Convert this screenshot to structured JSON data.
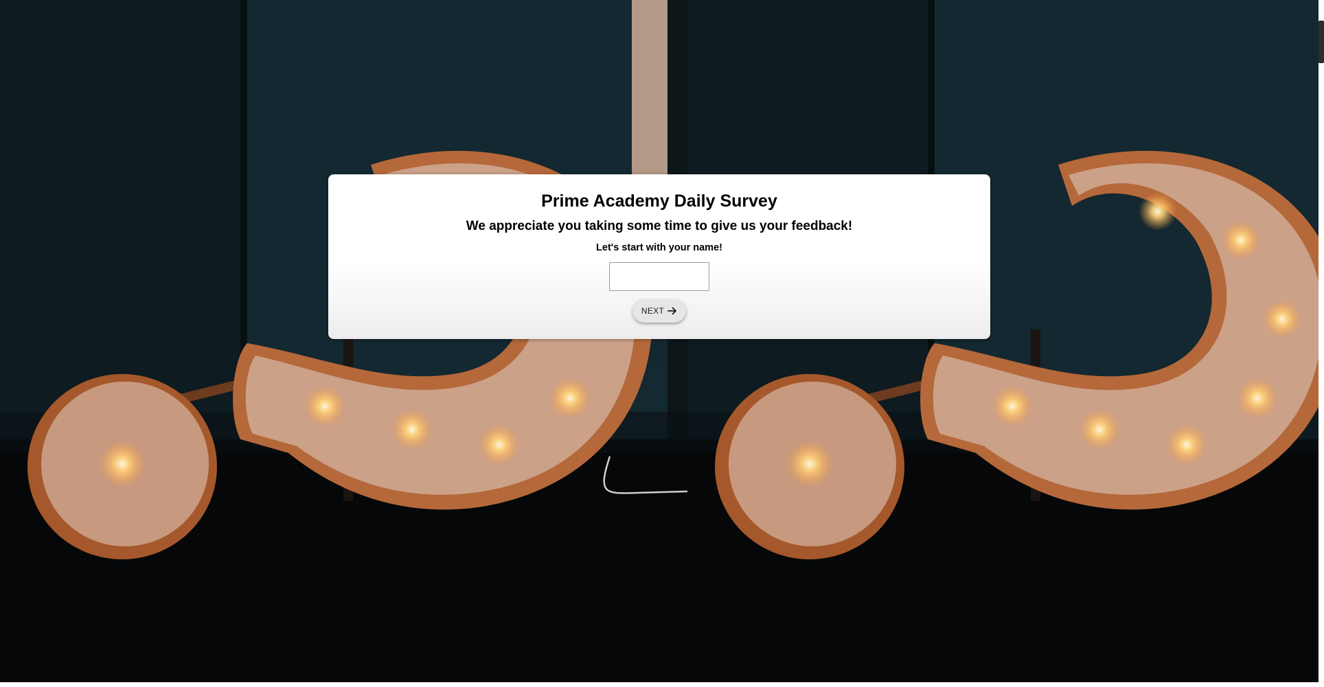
{
  "survey": {
    "title": "Prime Academy Daily Survey",
    "subtitle": "We appreciate you taking some time to give us your feedback!",
    "prompt": "Let's start with your name!",
    "name_value": "",
    "next_label": "NEXT",
    "next_icon": "arrow-right-icon"
  },
  "background": {
    "image": "question-mark-marquee-lights",
    "colors": {
      "wall": "#13252c",
      "floor": "#050607",
      "sign_face": "#cfa58a",
      "sign_rim": "#b86a3a",
      "bulb_glow": "#ffd27a"
    }
  }
}
